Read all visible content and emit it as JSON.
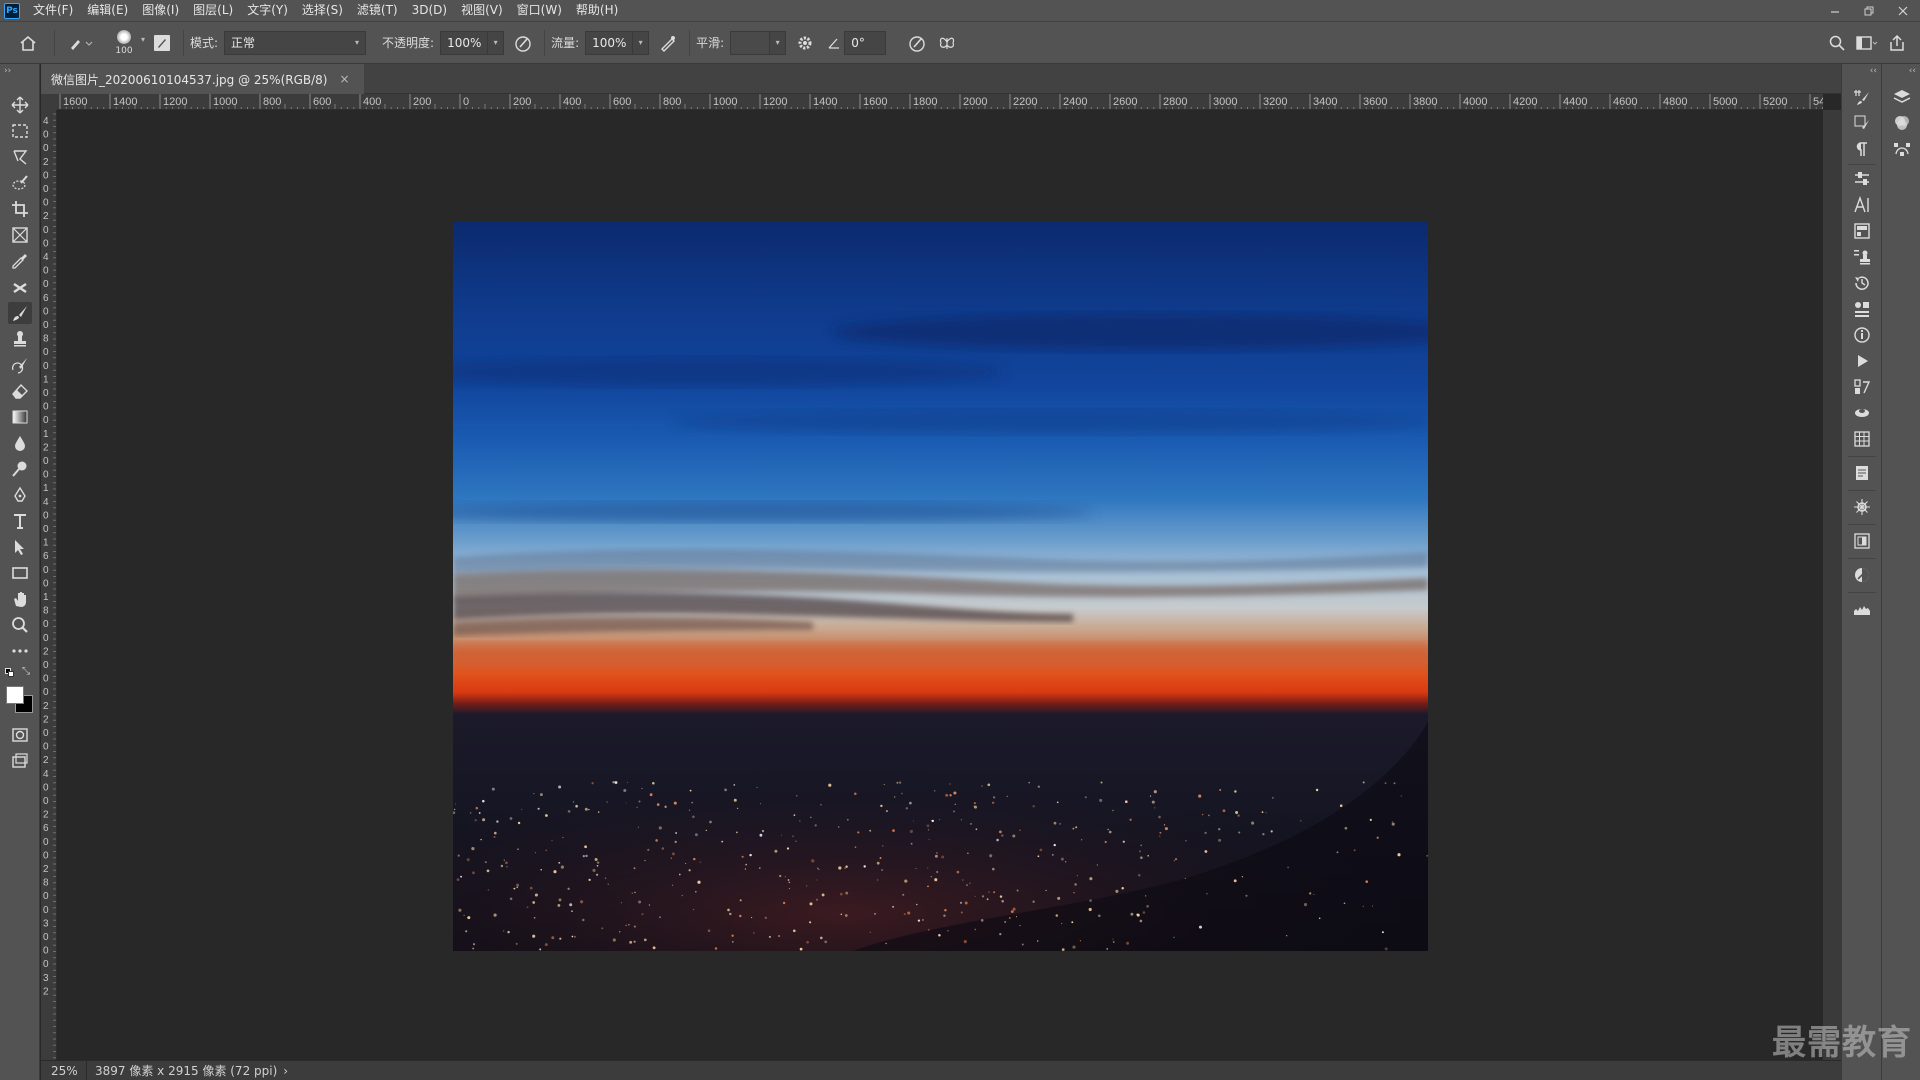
{
  "app": {
    "name": "Photoshop",
    "logo_text": "Ps"
  },
  "menu": [
    "文件(F)",
    "编辑(E)",
    "图像(I)",
    "图层(L)",
    "文字(Y)",
    "选择(S)",
    "滤镜(T)",
    "3D(D)",
    "视图(V)",
    "窗口(W)",
    "帮助(H)"
  ],
  "options": {
    "brush_size": "100",
    "mode_label": "模式:",
    "mode_value": "正常",
    "opacity_label": "不透明度:",
    "opacity_value": "100%",
    "flow_label": "流量:",
    "flow_value": "100%",
    "smoothing_label": "平滑:",
    "smoothing_value": "",
    "angle_value": "0°"
  },
  "document": {
    "tab_title": "微信图片_20200610104537.jpg @ 25%(RGB/8)",
    "close_glyph": "×"
  },
  "ruler_top": [
    "1600",
    "1400",
    "1200",
    "1000",
    "800",
    "600",
    "400",
    "200",
    "0",
    "200",
    "400",
    "600",
    "800",
    "1000",
    "1200",
    "1400",
    "1600",
    "1800",
    "2000",
    "2200",
    "2400",
    "2600",
    "2800",
    "3000",
    "3200",
    "3400",
    "3600",
    "3800",
    "4000",
    "4200",
    "4400",
    "4600",
    "4800",
    "5000",
    "5200",
    "54"
  ],
  "ruler_left": [
    "4",
    "0",
    "0",
    "2",
    "0",
    "0",
    "0",
    "2",
    "0",
    "0",
    "4",
    "0",
    "0",
    "6",
    "0",
    "0",
    "8",
    "0",
    "0",
    "1",
    "0",
    "0",
    "0",
    "1",
    "2",
    "0",
    "0",
    "1",
    "4",
    "0",
    "0",
    "1",
    "6",
    "0",
    "0",
    "1",
    "8",
    "0",
    "0",
    "2",
    "0",
    "0",
    "0",
    "2",
    "2",
    "0",
    "0",
    "2",
    "4",
    "0",
    "0",
    "2",
    "6",
    "0",
    "0",
    "2",
    "8",
    "0",
    "0",
    "3",
    "0",
    "0",
    "0",
    "3",
    "2"
  ],
  "status": {
    "zoom": "25%",
    "info": "3897 像素 x 2915 像素 (72 ppi)",
    "arrow": "›"
  },
  "watermark": "最需教育"
}
